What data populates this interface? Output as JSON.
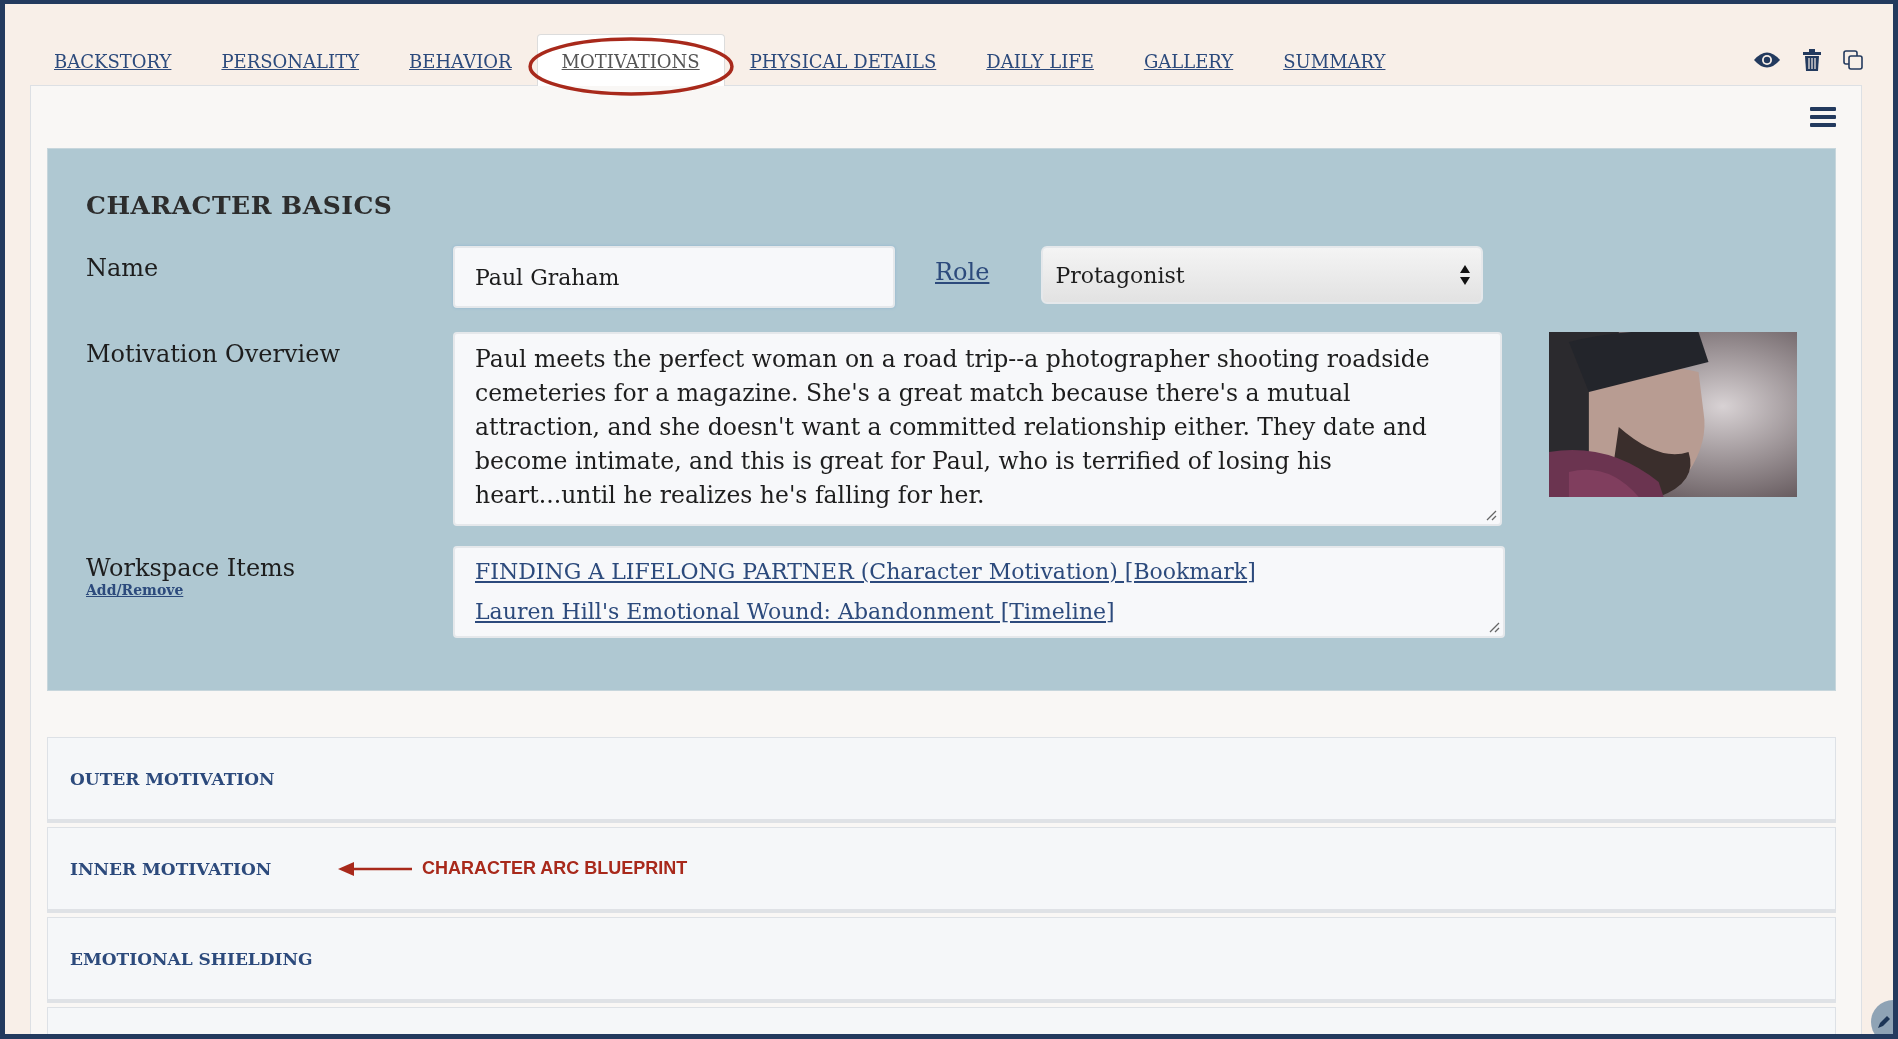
{
  "tabs": [
    {
      "label": "BACKSTORY",
      "selected": false
    },
    {
      "label": "PERSONALITY",
      "selected": false
    },
    {
      "label": "BEHAVIOR",
      "selected": false
    },
    {
      "label": "MOTIVATIONS",
      "selected": true
    },
    {
      "label": "PHYSICAL DETAILS",
      "selected": false
    },
    {
      "label": "DAILY LIFE",
      "selected": false
    },
    {
      "label": "GALLERY",
      "selected": false
    },
    {
      "label": "SUMMARY",
      "selected": false
    }
  ],
  "character_basics": {
    "title": "CHARACTER BASICS",
    "name_label": "Name",
    "name_value": "Paul Graham",
    "role_link": "Role",
    "role_value": "Protagonist",
    "overview_label": "Motivation Overview",
    "overview_text": "Paul meets the perfect woman on a road trip--a photographer shooting roadside cemeteries for a magazine. She's a great match because there's a mutual attraction, and she doesn't want a committed relationship either. They date and become intimate, and this is great for Paul, who is terrified of losing his heart...until he realizes he's falling for her.",
    "photo": {
      "kind": "picture"
    },
    "workspace_label": "Workspace Items",
    "workspace_action": "Add/Remove",
    "workspace_items": [
      "FINDING A LIFELONG PARTNER (Character Motivation) [Bookmark]",
      "Lauren Hill's Emotional Wound: Abandonment [Timeline]"
    ]
  },
  "sections": [
    {
      "title": "OUTER MOTIVATION"
    },
    {
      "title": "INNER MOTIVATION",
      "annotation": "CHARACTER ARC BLUEPRINT"
    },
    {
      "title": "EMOTIONAL SHIELDING"
    }
  ]
}
